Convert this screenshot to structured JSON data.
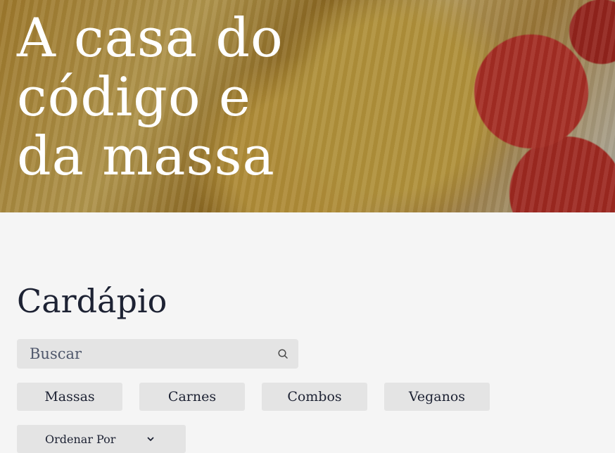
{
  "hero": {
    "title": "A casa do código e da massa"
  },
  "menu": {
    "title": "Cardápio",
    "search": {
      "placeholder": "Buscar"
    },
    "categories": [
      "Massas",
      "Carnes",
      "Combos",
      "Veganos"
    ],
    "sort": {
      "label": "Ordenar Por"
    }
  },
  "icons": {
    "search": "search-icon",
    "sort": "chevron-down-icon"
  },
  "colors": {
    "background": "#f5f5f5",
    "button_bg": "#e4e4e4",
    "text_dark": "#1d2233",
    "hero_text": "#ffffff"
  }
}
